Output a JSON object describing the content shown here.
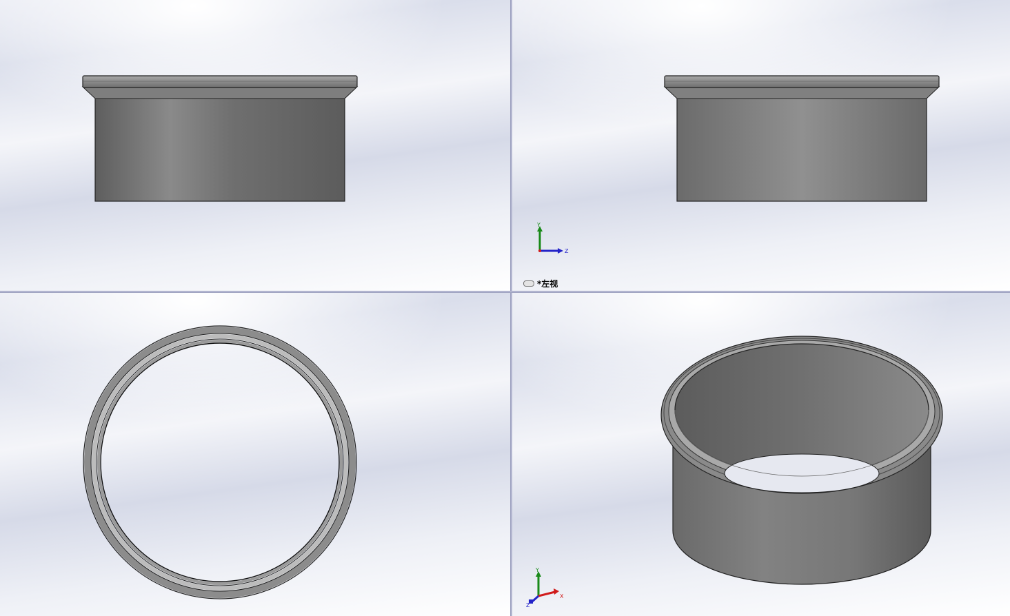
{
  "viewports": {
    "top_left": {
      "name": "front-view"
    },
    "top_right": {
      "name": "left-view",
      "label": "*左视",
      "triad": {
        "axis_vertical": "Y",
        "axis_horizontal": "Z"
      }
    },
    "bottom_left": {
      "name": "top-view"
    },
    "bottom_right": {
      "name": "isometric-view",
      "triad": {
        "axis_vertical": "Y",
        "axis_right": "X",
        "axis_depth": "Z"
      }
    }
  },
  "colors": {
    "part_dark": "#5e5e5e",
    "part_mid": "#7a7a7a",
    "part_light": "#8f8f8f",
    "axis_y": "#1a8a1a",
    "axis_z": "#2323c8",
    "axis_x": "#d01b1b",
    "divider": "#8e93b5"
  }
}
